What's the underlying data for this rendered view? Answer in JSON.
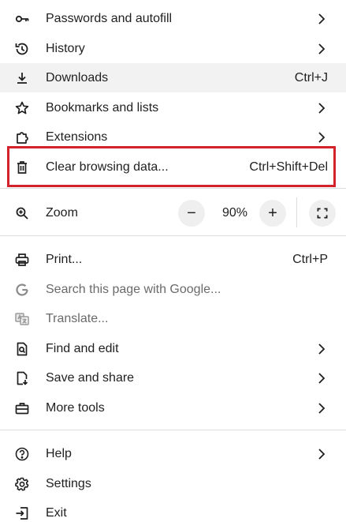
{
  "menu": {
    "passwords": {
      "label": "Passwords and autofill",
      "icon": "key-icon"
    },
    "history": {
      "label": "History",
      "icon": "history-icon"
    },
    "downloads": {
      "label": "Downloads",
      "shortcut": "Ctrl+J",
      "icon": "download-icon"
    },
    "bookmarks": {
      "label": "Bookmarks and lists",
      "icon": "star-icon"
    },
    "extensions": {
      "label": "Extensions",
      "icon": "puzzle-icon"
    },
    "clear": {
      "label": "Clear browsing data...",
      "shortcut": "Ctrl+Shift+Del",
      "icon": "trash-icon"
    },
    "zoom": {
      "label": "Zoom",
      "value": "90%",
      "minus": "−",
      "plus": "+",
      "icon": "zoom-icon"
    },
    "print": {
      "label": "Print...",
      "shortcut": "Ctrl+P",
      "icon": "printer-icon"
    },
    "search": {
      "label": "Search this page with Google...",
      "icon": "google-icon"
    },
    "translate": {
      "label": "Translate...",
      "icon": "translate-icon"
    },
    "find": {
      "label": "Find and edit",
      "icon": "find-icon"
    },
    "save": {
      "label": "Save and share",
      "icon": "save-share-icon"
    },
    "tools": {
      "label": "More tools",
      "icon": "toolbox-icon"
    },
    "help": {
      "label": "Help",
      "icon": "help-icon"
    },
    "settings": {
      "label": "Settings",
      "icon": "gear-icon"
    },
    "exit": {
      "label": "Exit",
      "icon": "exit-icon"
    }
  },
  "colors": {
    "highlight": "#d3222a",
    "hover_bg": "#f2f2f2",
    "text": "#1f1f1f",
    "disabled_text": "#6a6a6a",
    "divider": "#dadce0"
  }
}
